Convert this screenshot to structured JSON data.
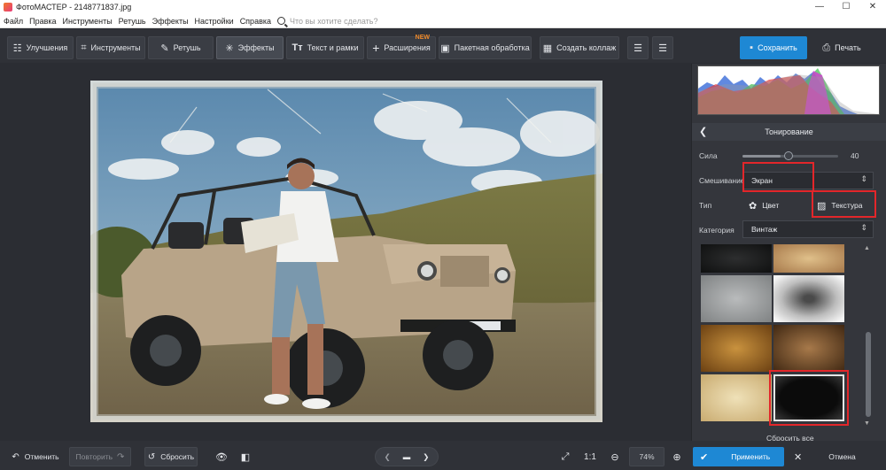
{
  "window": {
    "title": "ФотоМАСТЕР - 2148771837.jpg",
    "controls": [
      "—",
      "☐",
      "✕"
    ]
  },
  "menu": {
    "items": [
      "Файл",
      "Правка",
      "Инструменты",
      "Ретушь",
      "Эффекты",
      "Настройки",
      "Справка"
    ],
    "search_placeholder": "Что вы хотите сделать?"
  },
  "toolbar": {
    "tabs": [
      {
        "label": "Улучшения",
        "icon": "sliders-icon",
        "glyph": "☷"
      },
      {
        "label": "Инструменты",
        "icon": "crop-icon",
        "glyph": "⌗"
      },
      {
        "label": "Ретушь",
        "icon": "brush-icon",
        "glyph": "✎"
      },
      {
        "label": "Эффекты",
        "icon": "magic-wand-icon",
        "glyph": "✳"
      },
      {
        "label": "Текст и рамки",
        "icon": "text-icon",
        "glyph": "Tт"
      },
      {
        "label": "Расширения",
        "icon": "plus-icon",
        "glyph": "+",
        "badge": "NEW"
      },
      {
        "label": "Пакетная обработка",
        "icon": "image-icon",
        "glyph": "▣"
      },
      {
        "label": "Создать коллаж",
        "icon": "collage-icon",
        "glyph": "▦"
      }
    ],
    "active_tab": "Эффекты",
    "save_label": "Сохранить",
    "print_label": "Печать"
  },
  "panel": {
    "title": "Тонирование",
    "strength_label": "Сила",
    "strength_value": "40",
    "strength_fraction": 0.4,
    "blend_label": "Смешивание",
    "blend_value": "Экран",
    "type_label": "Тип",
    "type_color": "Цвет",
    "type_texture": "Текстура",
    "category_label": "Категория",
    "category_value": "Винтаж",
    "reset_all": "Сбросить все",
    "selected_texture_index": 7
  },
  "bottom": {
    "undo": "Отменить",
    "redo": "Повторить",
    "reset": "Сбросить",
    "ratio": "1:1",
    "zoom": "74%",
    "apply": "Применить",
    "cancel": "Отмена"
  },
  "colors": {
    "accent": "#1e88d4",
    "highlight": "#e3262a",
    "new_badge": "#f08a2a"
  }
}
